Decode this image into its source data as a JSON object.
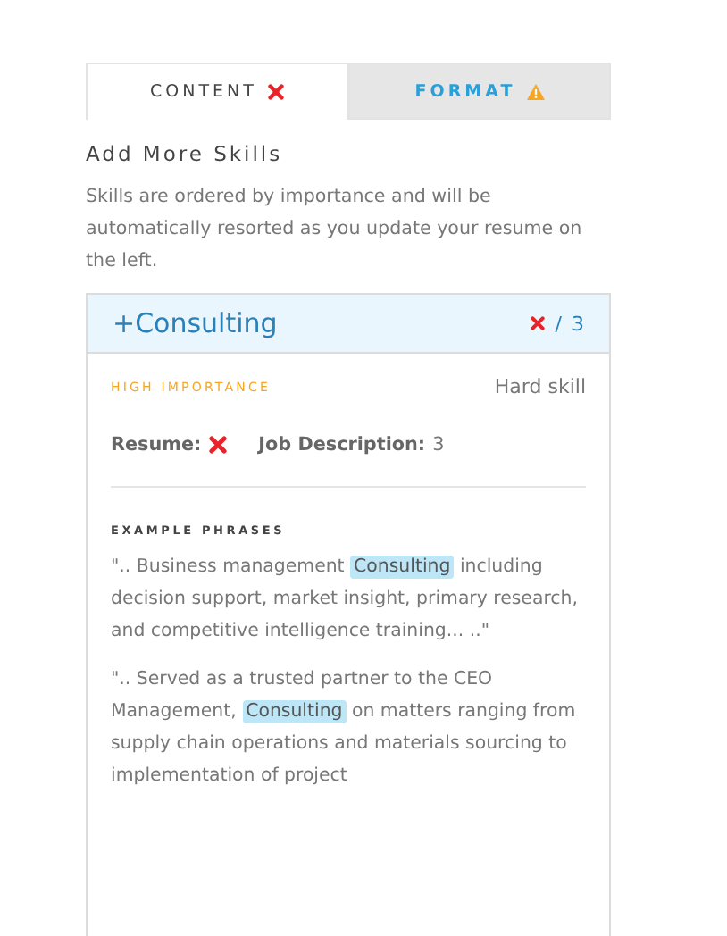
{
  "tabs": [
    {
      "label": "CONTENT",
      "selected": true,
      "kind": "error"
    },
    {
      "label": "FORMAT",
      "selected": false,
      "kind": "warning"
    }
  ],
  "heading": "Add More Skills",
  "description": "Skills are ordered by importance and will be automatically resorted as you update your resume on the left.",
  "skill": {
    "plus": "+",
    "name": "Consulting",
    "found": false,
    "count": "/ 3",
    "importance": "HIGH IMPORTANCE",
    "type": "Hard skill",
    "resume_label": "Resume:",
    "resume_found": false,
    "job_label": "Job Description:",
    "job_count": "3",
    "phrases_title": "EXAMPLE PHRASES",
    "phrases": [
      [
        {
          "text": "\".. Business management ",
          "highlight": false
        },
        {
          "text": "Consulting",
          "highlight": true
        },
        {
          "text": " including decision support, market insight, primary research, and competitive intelligence training... ..\"",
          "highlight": false
        }
      ],
      [
        {
          "text": "\".. Served as a trusted partner to the CEO Management, ",
          "highlight": false
        },
        {
          "text": "Consulting",
          "highlight": true
        },
        {
          "text": " on matters ranging from supply chain operations and materials sourcing to implementation of project",
          "highlight": false
        }
      ]
    ]
  }
}
